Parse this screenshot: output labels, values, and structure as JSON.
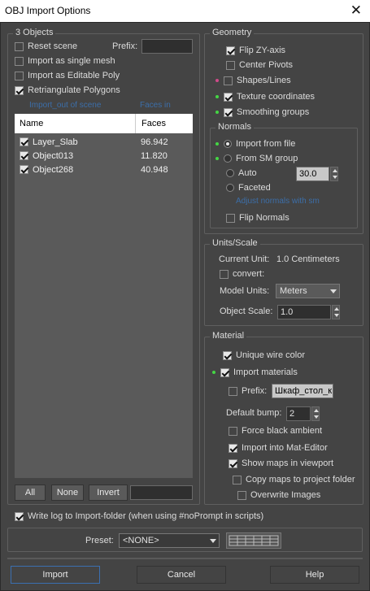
{
  "window": {
    "title": "OBJ Import Options",
    "close_glyph": "✕"
  },
  "objects": {
    "legend": "3 Objects",
    "reset_scene": "Reset scene",
    "prefix_label": "Prefix:",
    "prefix_value": "",
    "single_mesh": "Import as single mesh",
    "editable_poly": "Import as Editable Poly",
    "retriangulate": "Retriangulate Polygons",
    "faint_left": "Import_out of scene",
    "faint_right": "Faces in",
    "columns": {
      "name": "Name",
      "faces": "Faces"
    },
    "rows": [
      {
        "name": "Layer_Slab",
        "faces": "96.942",
        "checked": true
      },
      {
        "name": "Object013",
        "faces": "11.820",
        "checked": true
      },
      {
        "name": "Object268",
        "faces": "40.948",
        "checked": true
      }
    ],
    "btn_all": "All",
    "btn_none": "None",
    "btn_invert": "Invert",
    "filter_value": ""
  },
  "geometry": {
    "legend": "Geometry",
    "flip_zy": "Flip ZY-axis",
    "center_pivots": "Center Pivots",
    "shapes_lines": "Shapes/Lines",
    "texture_coords": "Texture coordinates",
    "smoothing_groups": "Smoothing groups",
    "normals": {
      "legend": "Normals",
      "import_from_file": "Import from file",
      "from_sm_group": "From SM group",
      "auto": "Auto",
      "auto_value": "30.0",
      "faceted": "Faceted",
      "faint": "Adjust normals with sm",
      "flip_normals": "Flip Normals"
    }
  },
  "units": {
    "legend": "Units/Scale",
    "current_unit_label": "Current Unit:",
    "current_unit_value": "1.0 Centimeters",
    "convert": "convert:",
    "model_units_label": "Model Units:",
    "model_units_value": "Meters",
    "object_scale_label": "Object Scale:",
    "object_scale_value": "1.0"
  },
  "material": {
    "legend": "Material",
    "unique_wire": "Unique wire color",
    "import_materials": "Import materials",
    "prefix_label": "Prefix:",
    "prefix_value": "Шкаф_стол_к",
    "default_bump_label": "Default bump:",
    "default_bump_value": "2",
    "force_black": "Force black ambient",
    "import_mat_editor": "Import into Mat-Editor",
    "show_maps": "Show maps in viewport",
    "copy_maps": "Copy maps to project folder",
    "overwrite_images": "Overwrite Images"
  },
  "log": {
    "write_log": "Write log to Import-folder (when using #noPrompt in scripts)"
  },
  "preset": {
    "label": "Preset:",
    "value": "<NONE>"
  },
  "footer": {
    "import": "Import",
    "cancel": "Cancel",
    "help": "Help"
  }
}
